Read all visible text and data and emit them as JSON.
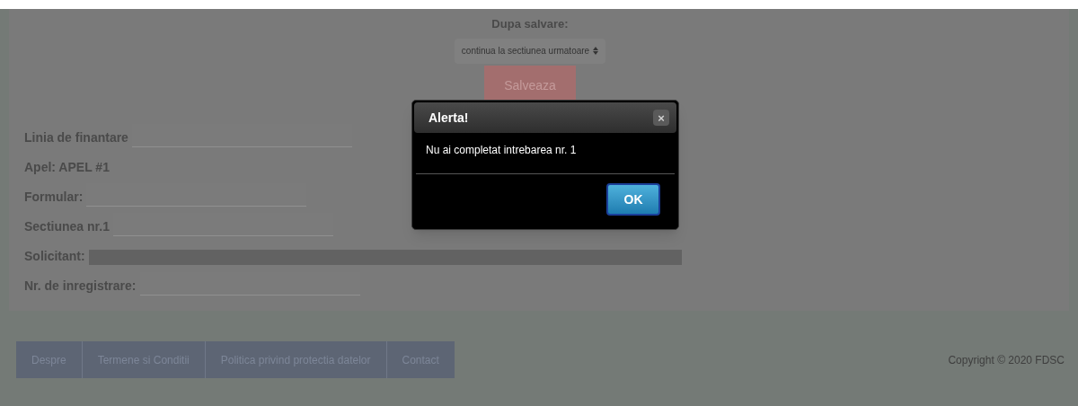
{
  "save_section": {
    "label": "Dupa salvare:",
    "select_value": "continua la sectiunea urmatoare",
    "save_button": "Salveaza"
  },
  "info_rows": [
    {
      "label": "Linia de finantare",
      "kind": "field"
    },
    {
      "label": "Apel: APEL #1",
      "kind": "text"
    },
    {
      "label": "Formular:",
      "kind": "field"
    },
    {
      "label": "Sectiunea nr.1",
      "kind": "field"
    },
    {
      "label": "Solicitant:",
      "kind": "redacted"
    },
    {
      "label": "Nr. de inregistrare:",
      "kind": "field"
    }
  ],
  "footer": {
    "links": [
      "Despre",
      "Termene si Conditii",
      "Politica privind protectia datelor",
      "Contact"
    ],
    "copyright": "Copyright © 2020 FDSC"
  },
  "dialog": {
    "title": "Alerta!",
    "close": "×",
    "message": "Nu ai completat intrebarea nr. 1",
    "ok_button": "OK"
  }
}
